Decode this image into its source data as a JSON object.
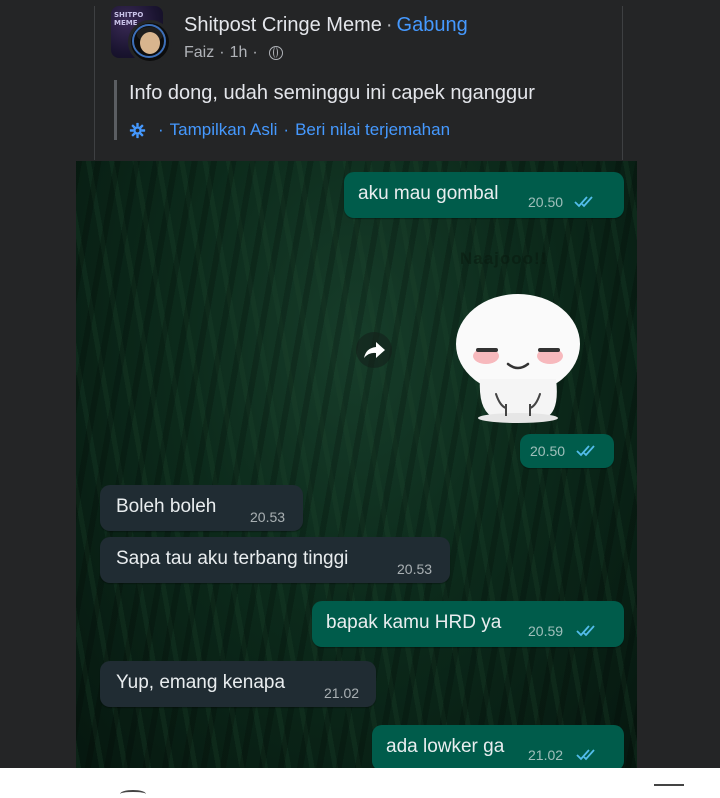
{
  "post": {
    "group_name": "Shitpost Cringe Meme",
    "separator": "·",
    "join_label": "Gabung",
    "author": "Faiz",
    "time": "1h",
    "group_avatar_text": "SHITPO\nMEME",
    "text": "Info dong, udah seminggu ini capek nganggur",
    "translation": {
      "show_original": "Tampilkan Asli",
      "rate_translation": "Beri nilai terjemahan",
      "icon": "gear-icon"
    }
  },
  "chat": {
    "messages": [
      {
        "direction": "out",
        "text": "aku mau gombal",
        "time": "20.50",
        "status": "read"
      },
      {
        "direction": "out",
        "type": "sticker",
        "sticker_text": "Naajooo!!",
        "time": "20.50",
        "status": "read"
      },
      {
        "direction": "in",
        "text": "Boleh boleh",
        "time": "20.53"
      },
      {
        "direction": "in",
        "text": "Sapa tau aku terbang tinggi",
        "time": "20.53"
      },
      {
        "direction": "out",
        "text": "bapak kamu HRD ya",
        "time": "20.59",
        "status": "read"
      },
      {
        "direction": "in",
        "text": "Yup, emang kenapa",
        "time": "21.02"
      },
      {
        "direction": "out",
        "text": "ada lowker ga",
        "time": "21.02",
        "status": "read"
      }
    ],
    "colors": {
      "outgoing": "#005c4b",
      "incoming": "#202c33",
      "read_ticks": "#53bdeb"
    }
  },
  "theme": {
    "background": "#242526",
    "link": "#4599ff",
    "text_primary": "#e4e6eb",
    "text_secondary": "#b0b3b8"
  }
}
